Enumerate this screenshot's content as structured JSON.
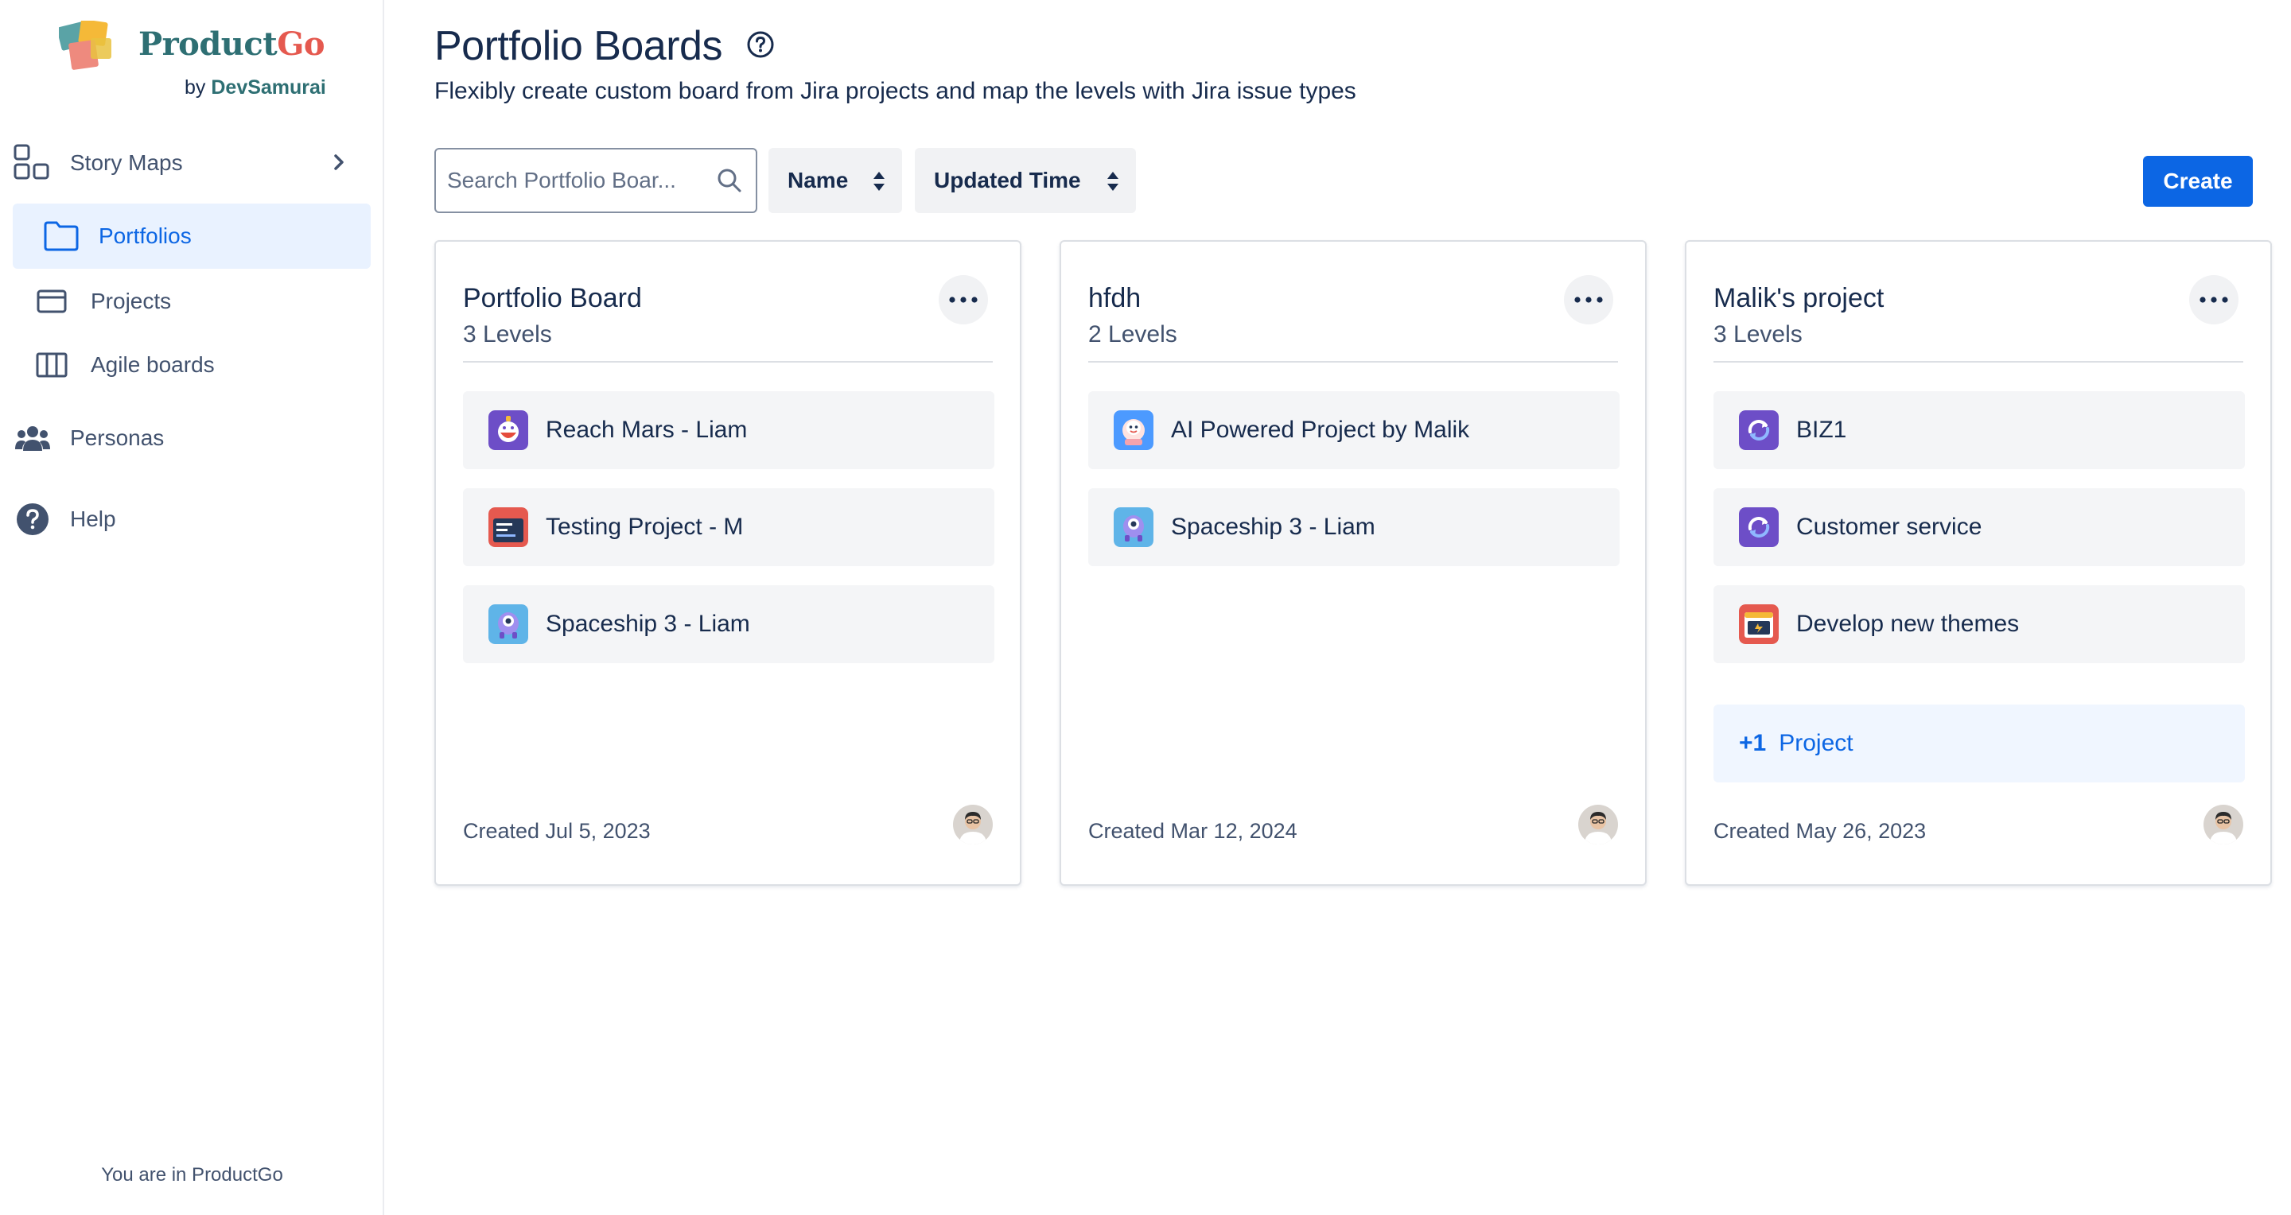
{
  "brand": {
    "name_a": "Product",
    "name_b": "Go",
    "by_prefix": "by ",
    "by_name": "DevSamurai"
  },
  "sidebar": {
    "items": [
      {
        "label": "Story Maps",
        "icon": "story-maps-icon"
      },
      {
        "label": "Portfolios",
        "icon": "folder-icon",
        "active": true
      },
      {
        "label": "Projects",
        "icon": "projects-icon"
      },
      {
        "label": "Agile boards",
        "icon": "board-columns-icon"
      },
      {
        "label": "Personas",
        "icon": "people-icon"
      },
      {
        "label": "Help",
        "icon": "help-icon"
      }
    ],
    "footer": "You are in ProductGo"
  },
  "header": {
    "title": "Portfolio Boards",
    "subtitle": "Flexibly create custom board from Jira projects and map the levels with Jira issue types"
  },
  "toolbar": {
    "search_placeholder": "Search Portfolio Boar...",
    "search_value": "",
    "sort_name": "Name",
    "sort_time": "Updated Time",
    "create_label": "Create"
  },
  "boards": [
    {
      "title": "Portfolio Board",
      "levels": "3 Levels",
      "projects": [
        {
          "name": "Reach Mars - Liam",
          "icon": "reach-mars-project-icon"
        },
        {
          "name": "Testing Project - M",
          "icon": "testing-project-icon"
        },
        {
          "name": "Spaceship 3 - Liam",
          "icon": "spaceship-project-icon"
        }
      ],
      "created": "Created Jul 5, 2023"
    },
    {
      "title": "hfdh",
      "levels": "2 Levels",
      "projects": [
        {
          "name": "AI Powered Project by Malik",
          "icon": "ai-project-icon"
        },
        {
          "name": "Spaceship 3 - Liam",
          "icon": "spaceship-project-icon"
        }
      ],
      "created": "Created Mar 12, 2024"
    },
    {
      "title": "Malik's project",
      "levels": "3 Levels",
      "projects": [
        {
          "name": "BIZ1",
          "icon": "sync-project-icon"
        },
        {
          "name": "Customer service",
          "icon": "sync-project-icon"
        },
        {
          "name": "Develop new themes",
          "icon": "themes-project-icon"
        }
      ],
      "more": {
        "count": "+1",
        "label": "Project"
      },
      "created": "Created May 26, 2023"
    }
  ],
  "colors": {
    "accent": "#0c66e4",
    "active_bg": "#e9f2ff",
    "brand_teal": "#2e6f73",
    "brand_red": "#e5594f"
  }
}
